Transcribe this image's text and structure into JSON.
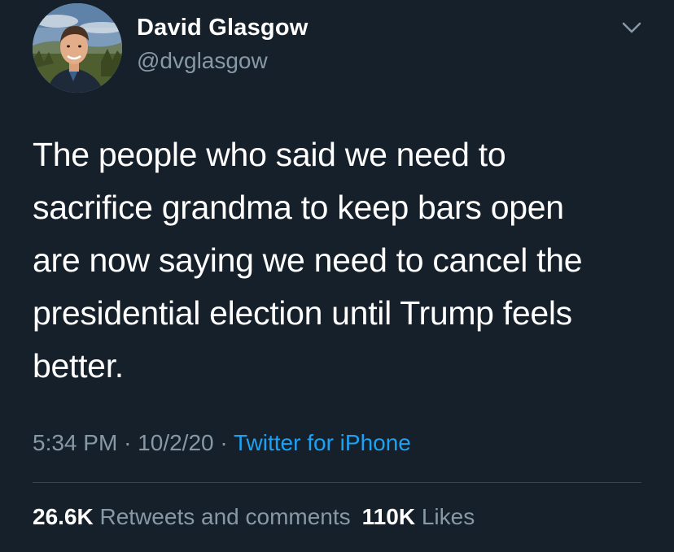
{
  "tweet": {
    "author": {
      "name": "David Glasgow",
      "handle": "@dvglasgow",
      "avatar_icon": "profile-photo"
    },
    "menu_icon": "chevron-down-icon",
    "text": "The people who said we need to\nsacrifice grandma to keep bars open\nare now saying we need to cancel the\npresidential election until Trump feels\nbetter.",
    "time": "5:34 PM",
    "separator": "·",
    "date": "10/2/20",
    "source": "Twitter for iPhone",
    "stats": {
      "retweets_count": "26.6K",
      "retweets_label": "Retweets and comments",
      "likes_count": "110K",
      "likes_label": "Likes"
    }
  },
  "colors": {
    "background": "#15202b",
    "primary_text": "#ffffff",
    "secondary_text": "#8899a6",
    "link": "#1da1f2",
    "divider": "#38444d"
  }
}
